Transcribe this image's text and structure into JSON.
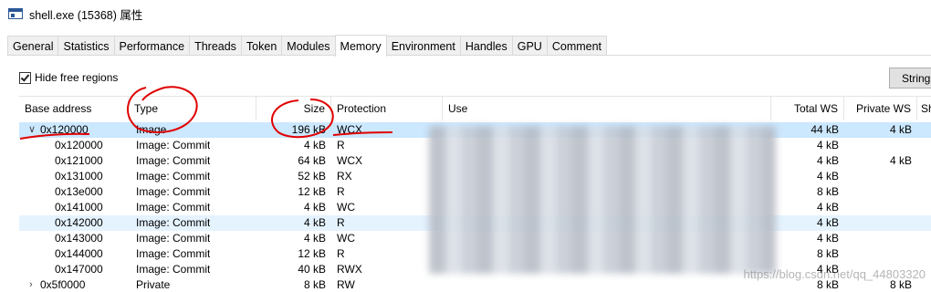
{
  "window": {
    "title": "shell.exe (15368) 属性"
  },
  "tabs": [
    {
      "label": "General"
    },
    {
      "label": "Statistics"
    },
    {
      "label": "Performance"
    },
    {
      "label": "Threads"
    },
    {
      "label": "Token"
    },
    {
      "label": "Modules"
    },
    {
      "label": "Memory"
    },
    {
      "label": "Environment"
    },
    {
      "label": "Handles"
    },
    {
      "label": "GPU"
    },
    {
      "label": "Comment"
    }
  ],
  "active_tab": "Memory",
  "toolbar": {
    "hide_free_label": "Hide free regions",
    "hide_free_checked": true,
    "strings_label": "Strings"
  },
  "table": {
    "columns": {
      "base": "Base address",
      "type": "Type",
      "size": "Size",
      "protection": "Protection",
      "use": "Use",
      "total_ws": "Total WS",
      "private_ws": "Private WS",
      "shareable": "Sh"
    },
    "rows": [
      {
        "base": "0x120000",
        "type": "Image",
        "size": "196 kB",
        "protection": "WCX",
        "total_ws": "44 kB",
        "private_ws": "4 kB",
        "shareable": "",
        "expander": "expanded"
      },
      {
        "base": "0x120000",
        "type": "Image: Commit",
        "size": "4 kB",
        "protection": "R",
        "total_ws": "4 kB",
        "private_ws": "",
        "shareable": ""
      },
      {
        "base": "0x121000",
        "type": "Image: Commit",
        "size": "64 kB",
        "protection": "WCX",
        "total_ws": "4 kB",
        "private_ws": "4 kB",
        "shareable": ""
      },
      {
        "base": "0x131000",
        "type": "Image: Commit",
        "size": "52 kB",
        "protection": "RX",
        "total_ws": "4 kB",
        "private_ws": "",
        "shareable": ""
      },
      {
        "base": "0x13e000",
        "type": "Image: Commit",
        "size": "12 kB",
        "protection": "R",
        "total_ws": "8 kB",
        "private_ws": "",
        "shareable": ""
      },
      {
        "base": "0x141000",
        "type": "Image: Commit",
        "size": "4 kB",
        "protection": "WC",
        "total_ws": "4 kB",
        "private_ws": "",
        "shareable": ""
      },
      {
        "base": "0x142000",
        "type": "Image: Commit",
        "size": "4 kB",
        "protection": "R",
        "total_ws": "4 kB",
        "private_ws": "",
        "shareable": ""
      },
      {
        "base": "0x143000",
        "type": "Image: Commit",
        "size": "4 kB",
        "protection": "WC",
        "total_ws": "4 kB",
        "private_ws": "",
        "shareable": ""
      },
      {
        "base": "0x144000",
        "type": "Image: Commit",
        "size": "12 kB",
        "protection": "R",
        "total_ws": "8 kB",
        "private_ws": "",
        "shareable": ""
      },
      {
        "base": "0x147000",
        "type": "Image: Commit",
        "size": "40 kB",
        "protection": "RWX",
        "total_ws": "4 kB",
        "private_ws": "",
        "shareable": ""
      },
      {
        "base": "0x5f0000",
        "type": "Private",
        "size": "8 kB",
        "protection": "RW",
        "total_ws": "8 kB",
        "private_ws": "8 kB",
        "shareable": "",
        "expander": "collapsed"
      }
    ],
    "selected_row": 0,
    "hover_row": 6
  },
  "watermark": "https://blog.csdn.net/qq_44803320",
  "colors": {
    "selection": "#cce8ff",
    "hover": "#e5f3ff",
    "annotation": "#e00000"
  },
  "icons": [
    "window-icon",
    "checkbox-check-icon",
    "chevron-down-icon",
    "chevron-right-icon"
  ]
}
